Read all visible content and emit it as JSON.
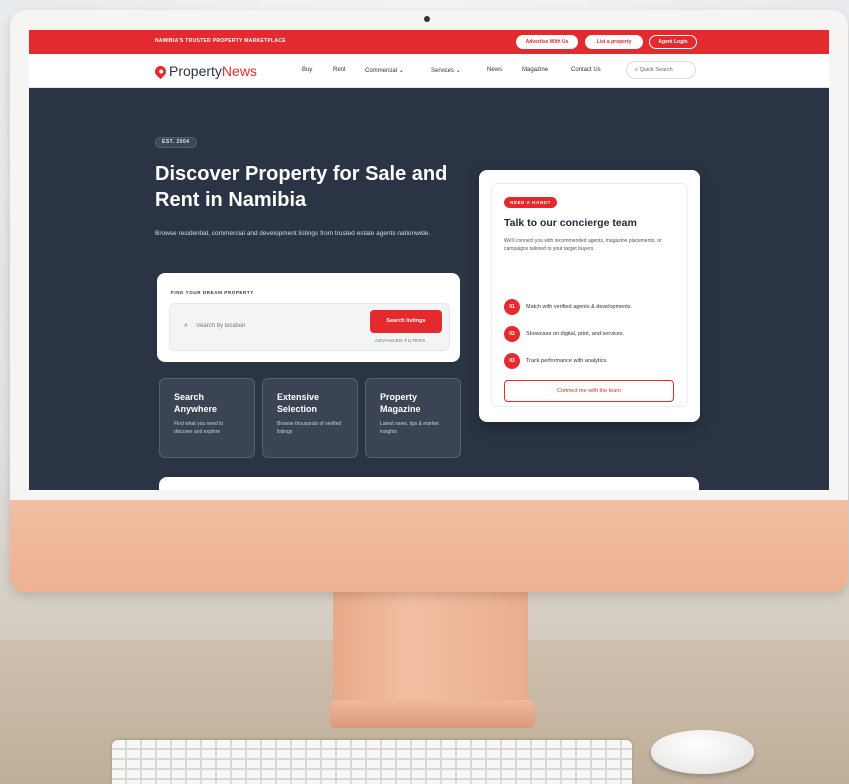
{
  "topbar": {
    "text": "NAMIBIA'S TRUSTED PROPERTY MARKETPLACE",
    "buttons": [
      "Advertise With Us",
      "List a property",
      "Agent Login"
    ]
  },
  "nav": {
    "logo_part1": "Property",
    "logo_part2": "News",
    "items": [
      "Buy",
      "Rent",
      "Commercial",
      "Services",
      "News",
      "Magazine",
      "Contact Us"
    ],
    "search_label": "Quick Search"
  },
  "hero": {
    "badge": "EST. 2004",
    "title": "Discover Property for Sale and Rent in Namibia",
    "subtitle": "Browse residential, commercial and development listings from trusted estate agents nationwide."
  },
  "search": {
    "label": "FIND YOUR DREAM PROPERTY",
    "placeholder": "Search by location",
    "button": "Search listings",
    "advanced": "ADVANCED FILTERS"
  },
  "features": [
    {
      "title": "Search Anywhere",
      "text": "Find what you need to discover and explore"
    },
    {
      "title": "Extensive Selection",
      "text": "Browse thousands of verified listings"
    },
    {
      "title": "Property Magazine",
      "text": "Latest news, tips & market insights"
    }
  ],
  "concierge": {
    "badge": "NEED A HAND?",
    "title": "Talk to our concierge team",
    "text": "We'll connect you with recommended agents, magazine placements, or campaigns tailored to your target buyers.",
    "steps": [
      {
        "num": "01",
        "text": "Match with verified agents & developments."
      },
      {
        "num": "02",
        "text": "Showcase on digital, print, and services."
      },
      {
        "num": "03",
        "text": "Track performance with analytics."
      }
    ],
    "button": "Connect me with the team"
  }
}
